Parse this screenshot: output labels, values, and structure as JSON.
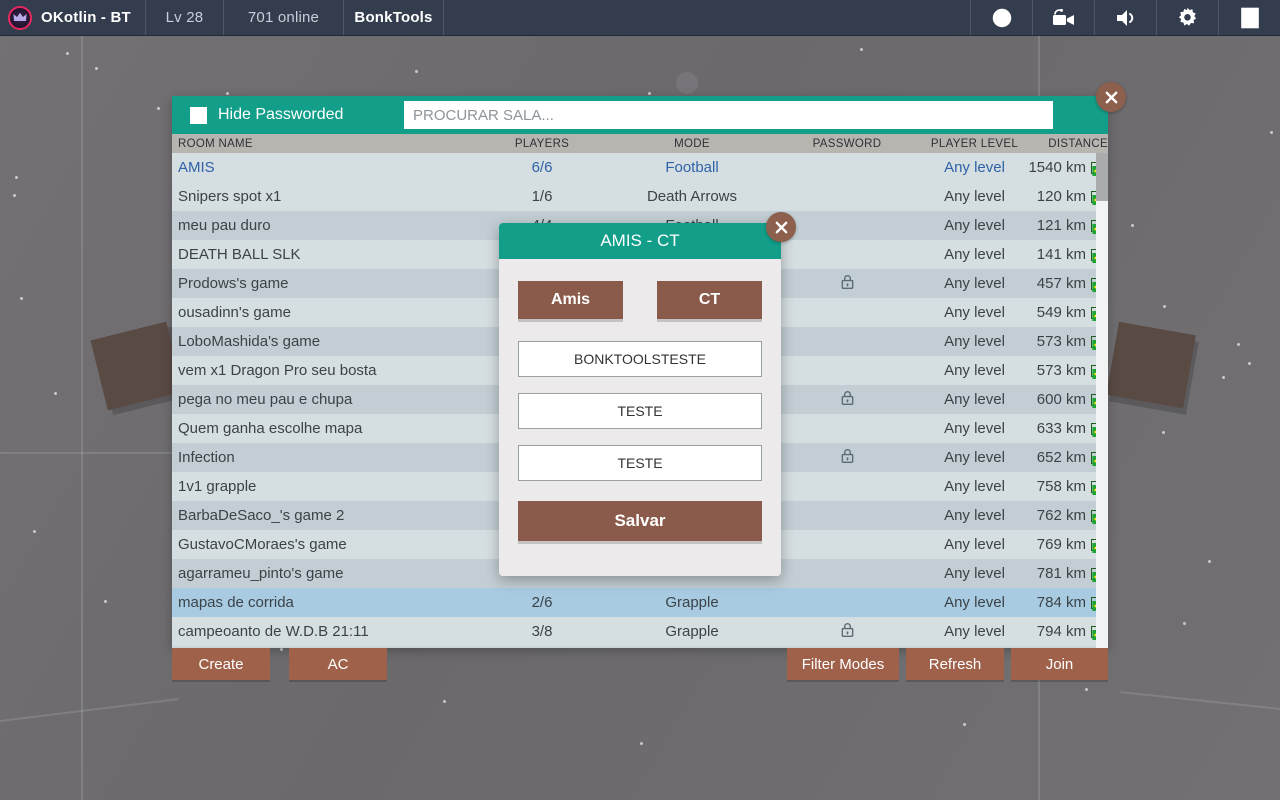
{
  "topbar": {
    "logo_icon": "crown-icon",
    "player_name": "OKotlin - BT",
    "level": "Lv 28",
    "online": "701 online",
    "tools": "BonkTools",
    "icons": [
      {
        "name": "eye-off-icon",
        "label": "Hide"
      },
      {
        "name": "video-camera-icon",
        "label": "Record"
      },
      {
        "name": "volume-icon",
        "label": "Sound"
      },
      {
        "name": "gear-icon",
        "label": "Settings"
      },
      {
        "name": "exit-door-icon",
        "label": "Exit"
      }
    ]
  },
  "roomlist": {
    "hide_passworded_label": "Hide Passworded",
    "hide_passworded_checked": false,
    "search_placeholder": "PROCURAR SALA...",
    "search_value": "",
    "close_icon": "close-icon",
    "columns": {
      "name": "ROOM NAME",
      "players": "PLAYERS",
      "mode": "MODE",
      "password": "PASSWORD",
      "level": "PLAYER LEVEL",
      "distance": "DISTANCE"
    },
    "accent_color": "#139e8a",
    "highlight_color": "#a8cbe2",
    "rows": [
      {
        "name": "AMIS",
        "players": "6/6",
        "mode": "Football",
        "locked": false,
        "level": "Any level",
        "distance": "1540 km",
        "flag": "br",
        "state": "active"
      },
      {
        "name": "Snipers spot x1",
        "players": "1/6",
        "mode": "Death Arrows",
        "locked": false,
        "level": "Any level",
        "distance": "120 km",
        "flag": "br",
        "state": "norm"
      },
      {
        "name": "meu pau duro",
        "players": "4/4",
        "mode": "Football",
        "locked": false,
        "level": "Any level",
        "distance": "121 km",
        "flag": "br",
        "state": "alt"
      },
      {
        "name": "DEATH BALL SLK",
        "players": "",
        "mode": "",
        "locked": false,
        "level": "Any level",
        "distance": "141 km",
        "flag": "br",
        "state": "norm"
      },
      {
        "name": "Prodows's game",
        "players": "",
        "mode": "",
        "locked": true,
        "level": "Any level",
        "distance": "457 km",
        "flag": "br",
        "state": "alt"
      },
      {
        "name": "ousadinn's game",
        "players": "",
        "mode": "",
        "locked": false,
        "level": "Any level",
        "distance": "549 km",
        "flag": "br",
        "state": "norm"
      },
      {
        "name": "LoboMashida's game",
        "players": "",
        "mode": "",
        "locked": false,
        "level": "Any level",
        "distance": "573 km",
        "flag": "br",
        "state": "alt"
      },
      {
        "name": "vem x1 Dragon Pro seu bosta",
        "players": "",
        "mode": "",
        "locked": false,
        "level": "Any level",
        "distance": "573 km",
        "flag": "br",
        "state": "norm"
      },
      {
        "name": "pega no meu pau e chupa",
        "players": "",
        "mode": "",
        "locked": true,
        "level": "Any level",
        "distance": "600 km",
        "flag": "br",
        "state": "alt"
      },
      {
        "name": "Quem ganha escolhe mapa",
        "players": "",
        "mode": "",
        "locked": false,
        "level": "Any level",
        "distance": "633 km",
        "flag": "br",
        "state": "norm"
      },
      {
        "name": "Infection",
        "players": "",
        "mode": "",
        "locked": true,
        "level": "Any level",
        "distance": "652 km",
        "flag": "br",
        "state": "alt"
      },
      {
        "name": "1v1 grapple",
        "players": "",
        "mode": "",
        "locked": false,
        "level": "Any level",
        "distance": "758 km",
        "flag": "br",
        "state": "norm"
      },
      {
        "name": "BarbaDeSaco_'s game 2",
        "players": "",
        "mode": "",
        "locked": false,
        "level": "Any level",
        "distance": "762 km",
        "flag": "br",
        "state": "alt"
      },
      {
        "name": "GustavoCMoraes's game",
        "players": "",
        "mode": "",
        "locked": false,
        "level": "Any level",
        "distance": "769 km",
        "flag": "br",
        "state": "norm"
      },
      {
        "name": "agarrameu_pinto's game",
        "players": "",
        "mode": "",
        "locked": false,
        "level": "Any level",
        "distance": "781 km",
        "flag": "br",
        "state": "alt"
      },
      {
        "name": "mapas de corrida",
        "players": "2/6",
        "mode": "Grapple",
        "locked": false,
        "level": "Any level",
        "distance": "784 km",
        "flag": "br",
        "state": "sel"
      },
      {
        "name": "campeoanto de W.D.B 21:11",
        "players": "3/8",
        "mode": "Grapple",
        "locked": true,
        "level": "Any level",
        "distance": "794 km",
        "flag": "br",
        "state": "norm"
      }
    ]
  },
  "buttons": {
    "create": "Create",
    "ac": "AC",
    "filter_modes": "Filter Modes",
    "refresh": "Refresh",
    "join": "Join"
  },
  "modal": {
    "title": "AMIS - CT",
    "close_icon": "close-icon",
    "team_left": "Amis",
    "team_right": "CT",
    "field1": "BONKTOOLSTESTE",
    "field2": "TESTE",
    "field3": "TESTE",
    "save": "Salvar",
    "accent_color": "#139e8a",
    "button_color": "#8a5b4a"
  }
}
